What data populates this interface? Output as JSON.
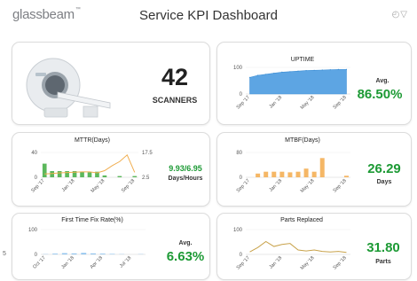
{
  "header": {
    "logo_text": "glassbeam",
    "logo_tm": "™",
    "title": "Service KPI Dashboard",
    "icons": [
      "clock-icon",
      "filter-icon"
    ]
  },
  "colors": {
    "accent_green": "#1d9a35",
    "uptime_fill": "#5da5e3",
    "mttr_bar": "#5cb85c",
    "mttr_line": "#f0ad4e",
    "mtbf_bar": "#f5b766",
    "ftfr_bar": "#8fc3ee",
    "parts_line": "#c8a24a"
  },
  "scanners": {
    "count": "42",
    "label": "SCANNERS"
  },
  "uptime": {
    "title": "UPTIME",
    "avg_label": "Avg.",
    "avg_value": "86.50%"
  },
  "mttr": {
    "title": "MTTR(Days)",
    "value": "9.93/6.95",
    "unit": "Days/Hours"
  },
  "mtbf": {
    "title": "MTBF(Days)",
    "value": "26.29",
    "unit": "Days"
  },
  "ftfr": {
    "title": "First Time Fix Rate(%)",
    "avg_label": "Avg.",
    "avg_value": "6.63%"
  },
  "parts": {
    "title": "Parts Replaced",
    "value": "31.80",
    "unit": "Parts"
  },
  "edge_mark": "5",
  "chart_data": [
    {
      "id": "uptime",
      "type": "area",
      "x": [
        "Sep '17",
        "Oct '17",
        "Nov '17",
        "Dec '17",
        "Jan '18",
        "Feb '18",
        "Mar '18",
        "Apr '18",
        "May '18",
        "Jun '18",
        "Jul '18",
        "Aug '18",
        "Sep '18"
      ],
      "values": [
        62,
        70,
        74,
        78,
        82,
        84,
        86,
        88,
        89,
        90,
        91,
        92,
        92
      ],
      "ylim": [
        0,
        100
      ],
      "yticks": [
        "0",
        "100"
      ],
      "xticklabels": [
        "Sep '17",
        "Jan '18",
        "May '18",
        "Sep '18"
      ],
      "xtick_idx": [
        0,
        4,
        8,
        12
      ]
    },
    {
      "id": "mttr",
      "type": "bar",
      "x": [
        "Sep '17",
        "Oct '17",
        "Nov '17",
        "Dec '17",
        "Jan '18",
        "Feb '18",
        "Mar '18",
        "Apr '18",
        "May '18",
        "Jun '18",
        "Jul '18",
        "Aug '18",
        "Sep '18"
      ],
      "series": [
        {
          "axis": "left",
          "values": [
            22,
            10,
            10,
            10,
            10,
            9,
            8,
            9,
            3,
            0,
            2,
            0,
            2
          ]
        },
        {
          "axis": "right",
          "values": [
            4.5,
            4.8,
            5.2,
            5.4,
            5.6,
            5.8,
            5.8,
            5.2,
            6.5,
            9.5,
            12,
            16,
            5.5
          ]
        }
      ],
      "ylim": [
        0,
        40
      ],
      "yticks": [
        "0",
        "40"
      ],
      "y2lim": [
        2.5,
        17.5
      ],
      "y2ticks": [
        "2.5",
        "17.5"
      ],
      "xticklabels": [
        "Sep '17",
        "Jan '18",
        "May '18",
        "Sep '18"
      ],
      "xtick_idx": [
        0,
        4,
        8,
        12
      ]
    },
    {
      "id": "mtbf",
      "type": "bar",
      "x": [
        "Sep '17",
        "Oct '17",
        "Nov '17",
        "Dec '17",
        "Jan '18",
        "Feb '18",
        "Mar '18",
        "Apr '18",
        "May '18",
        "Jun '18",
        "Jul '18",
        "Aug '18",
        "Sep '18"
      ],
      "values": [
        0,
        12,
        18,
        18,
        18,
        16,
        18,
        28,
        18,
        62,
        0,
        0,
        5
      ],
      "ylim": [
        0,
        80
      ],
      "yticks": [
        "0",
        "80"
      ],
      "xticklabels": [
        "Sep '17",
        "Jan '18",
        "May '18",
        "Sep '18"
      ],
      "xtick_idx": [
        0,
        4,
        8,
        12
      ]
    },
    {
      "id": "ftfr",
      "type": "bar",
      "x": [
        "Oct '17",
        "Nov '17",
        "Dec '17",
        "Jan '18",
        "Feb '18",
        "Mar '18",
        "Apr '18",
        "May '18",
        "Jun '18",
        "Jul '18",
        "Aug '18"
      ],
      "values": [
        1,
        3,
        5,
        4,
        6,
        4,
        3,
        2,
        1,
        0,
        1
      ],
      "ylim": [
        0,
        100
      ],
      "yticks": [
        "0",
        "100"
      ],
      "xticklabels": [
        "Oct '17",
        "Jan '18",
        "Apr '18",
        "Jul '18"
      ],
      "xtick_idx": [
        0,
        3,
        6,
        9
      ]
    },
    {
      "id": "parts",
      "type": "line",
      "x": [
        "Sep '17",
        "Oct '17",
        "Nov '17",
        "Dec '17",
        "Jan '18",
        "Feb '18",
        "Mar '18",
        "Apr '18",
        "May '18",
        "Jun '18",
        "Jul '18",
        "Aug '18",
        "Sep '18"
      ],
      "values": [
        10,
        28,
        52,
        32,
        40,
        44,
        18,
        14,
        18,
        12,
        10,
        12,
        8
      ],
      "ylim": [
        0,
        100
      ],
      "yticks": [
        "0",
        "100"
      ],
      "xticklabels": [
        "Sep '17",
        "Jan '18",
        "May '18",
        "Sep '18"
      ],
      "xtick_idx": [
        0,
        4,
        8,
        12
      ]
    }
  ]
}
